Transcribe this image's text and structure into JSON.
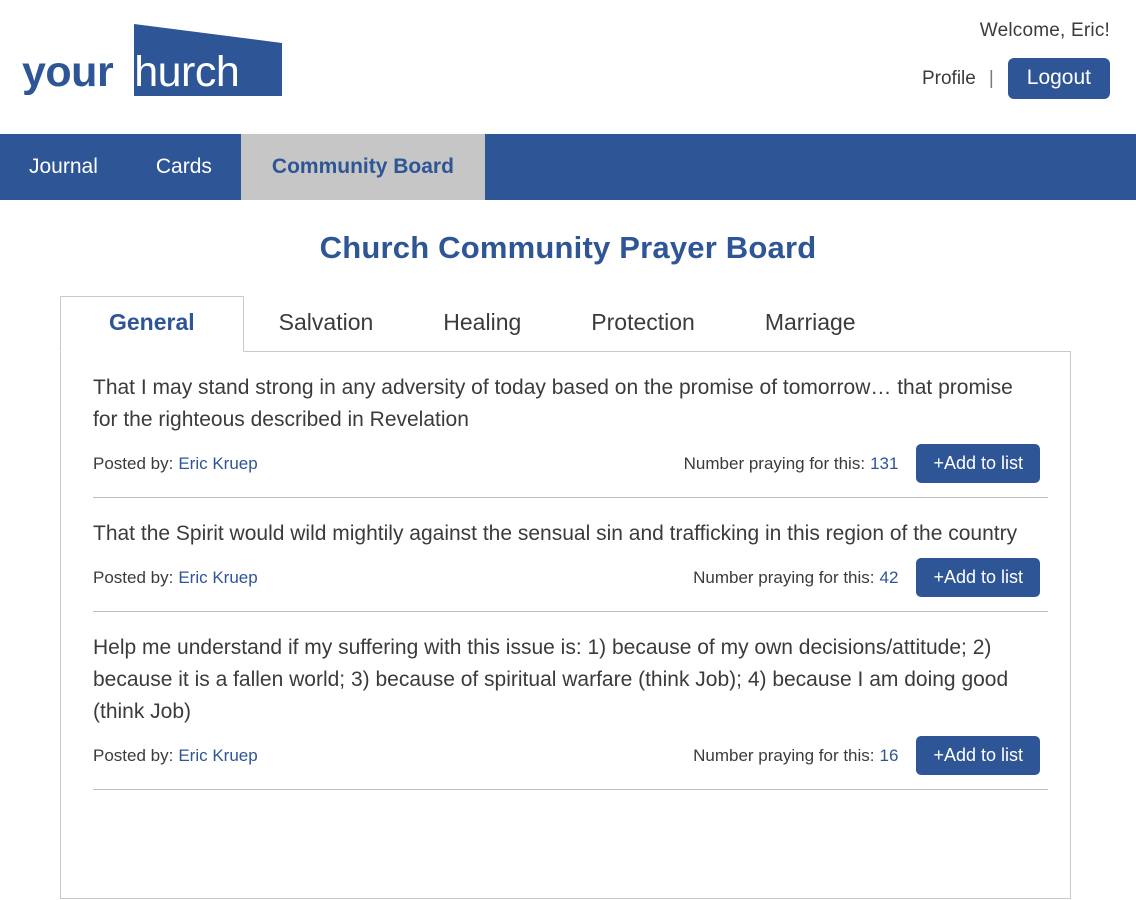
{
  "header": {
    "logo": {
      "primary": "your",
      "secondary": "church",
      "shape_color": "#2E5595",
      "primary_color": "#2E5595",
      "secondary_color": "#FFFFFF"
    },
    "welcome": "Welcome, Eric!",
    "profile_label": "Profile",
    "separator": "|",
    "logout_label": "Logout"
  },
  "nav": {
    "items": [
      {
        "label": "Journal",
        "active": false
      },
      {
        "label": "Cards",
        "active": false
      },
      {
        "label": "Community Board",
        "active": true
      }
    ],
    "bar_color": "#2E5595",
    "active_bg": "#C6C6C6",
    "active_text_color": "#2E5595"
  },
  "main": {
    "page_title": "Church Community Prayer Board",
    "title_color": "#2E5595",
    "tabs": [
      {
        "label": "General",
        "active": true
      },
      {
        "label": "Salvation",
        "active": false
      },
      {
        "label": "Healing",
        "active": false
      },
      {
        "label": "Protection",
        "active": false
      },
      {
        "label": "Marriage",
        "active": false
      }
    ],
    "labels": {
      "posted_by": "Posted by:",
      "number_praying": "Number praying for this:",
      "add_to_list": "+Add to list"
    },
    "prayers": [
      {
        "text": "That I may stand strong in any adversity of today based on the promise of tomorrow… that promise for the righteous described in Revelation",
        "author": "Eric Kruep",
        "count": "131"
      },
      {
        "text": "That the Spirit would wild mightily against the sensual sin and trafficking in this region of the country",
        "author": "Eric Kruep",
        "count": "42"
      },
      {
        "text": "Help me understand if my suffering with this issue is: 1) because of my own decisions/attitude; 2) because it is a fallen world; 3) because of spiritual warfare (think Job); 4) because I am doing good (think Job)",
        "author": "Eric Kruep",
        "count": "16"
      }
    ]
  },
  "colors": {
    "brand_blue": "#2E5595",
    "active_tab_gray": "#C6C6C6",
    "card_border": "#C9C9C9",
    "text": "#3B3B3B"
  }
}
